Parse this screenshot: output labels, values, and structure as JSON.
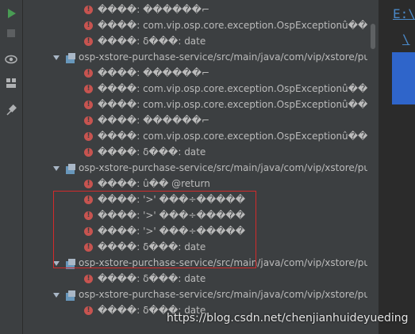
{
  "editor": {
    "path_label": "E:\\",
    "path_label2": "\\"
  },
  "tree": {
    "rows": [
      {
        "type": "error",
        "text": "����: ������⌐"
      },
      {
        "type": "error",
        "text": "����: com.vip.osp.core.exception.OspExceptionû�� @"
      },
      {
        "type": "error",
        "text": "����: δ���: date"
      },
      {
        "type": "file",
        "text": "osp-xstore-purchase-service/src/main/java/com/vip/xstore/pu"
      },
      {
        "type": "error",
        "text": "����: ������⌐"
      },
      {
        "type": "error",
        "text": "����: com.vip.osp.core.exception.OspExceptionû�� @"
      },
      {
        "type": "error",
        "text": "����: com.vip.osp.core.exception.OspExceptionû�� @"
      },
      {
        "type": "error",
        "text": "����: ������⌐"
      },
      {
        "type": "error",
        "text": "����: com.vip.osp.core.exception.OspExceptionû�� @"
      },
      {
        "type": "error",
        "text": "����: δ���: date"
      },
      {
        "type": "file",
        "text": "osp-xstore-purchase-service/src/main/java/com/vip/xstore/pu"
      },
      {
        "type": "error",
        "text": "����: û�� @return"
      },
      {
        "type": "error",
        "text": "����: '>' ���÷�����"
      },
      {
        "type": "error",
        "text": "����: '>' ���÷�����"
      },
      {
        "type": "error",
        "text": "����: '>' ���÷�����"
      },
      {
        "type": "error",
        "text": "����: δ���: date"
      },
      {
        "type": "file",
        "text": "osp-xstore-purchase-service/src/main/java/com/vip/xstore/pu"
      },
      {
        "type": "error",
        "text": "����: δ���: date"
      },
      {
        "type": "file",
        "text": "osp-xstore-purchase-service/src/main/java/com/vip/xstore/pu"
      },
      {
        "type": "error",
        "text": "����: δ���: date"
      }
    ]
  },
  "watermark": "https://blog.csdn.net/chenjianhuideyueding",
  "colors": {
    "background": "#3c3f41",
    "error": "#c75450",
    "highlight": "#d22b2b",
    "link": "#4a88c7"
  }
}
